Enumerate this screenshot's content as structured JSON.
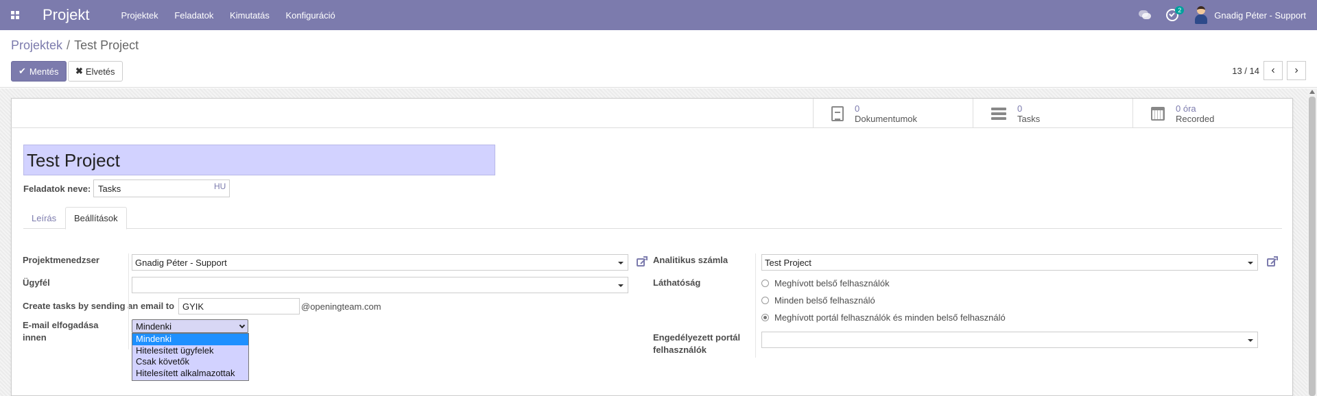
{
  "topbar": {
    "app_name": "Projekt",
    "menu": [
      "Projektek",
      "Feladatok",
      "Kimutatás",
      "Konfiguráció"
    ],
    "activity_badge": "2",
    "user_name": "Gnadig Péter - Support",
    "background_color": "#7c7bad"
  },
  "breadcrumb": {
    "parent": "Projektek",
    "separator": "/",
    "current": "Test Project"
  },
  "actions": {
    "save_label": "Mentés",
    "discard_label": "Elvetés"
  },
  "pager": {
    "value": "13 / 14"
  },
  "stat_buttons": [
    {
      "value": "0",
      "label": "Dokumentumok",
      "icon": "document-icon"
    },
    {
      "value": "0",
      "label": "Tasks",
      "icon": "tasks-icon"
    },
    {
      "value": "0 óra",
      "label": "Recorded",
      "icon": "calendar-icon"
    }
  ],
  "form": {
    "title": "Test Project",
    "tasks_name_label": "Feladatok neve:",
    "tasks_name_value": "Tasks",
    "lang_tag": "HU",
    "tabs": [
      "Leírás",
      "Beállítások"
    ],
    "active_tab": "Beállítások",
    "left": {
      "manager_label": "Projektmenedzser",
      "manager_value": "Gnadig Péter - Support",
      "customer_label": "Ügyfél",
      "customer_value": "",
      "email_label": "Create tasks by sending an email to",
      "email_value": "GYIK",
      "email_domain": "@openingteam.com",
      "accept_label_1": "E-mail elfogadása",
      "accept_label_2": "innen",
      "accept_value": "Mindenki",
      "accept_options": [
        "Mindenki",
        "Hitelesített ügyfelek",
        "Csak követők",
        "Hitelesített alkalmazottak"
      ]
    },
    "right": {
      "analytic_label": "Analitikus számla",
      "analytic_value": "Test Project",
      "visibility_label": "Láthatóság",
      "visibility_options": [
        "Meghívott belső felhasználók",
        "Minden belső felhasználó",
        "Meghívott portál felhasználók és minden belső felhasználó"
      ],
      "visibility_selected_index": 2,
      "portal_label_1": "Engedélyezett portál",
      "portal_label_2": "felhasználók",
      "portal_value": ""
    }
  }
}
